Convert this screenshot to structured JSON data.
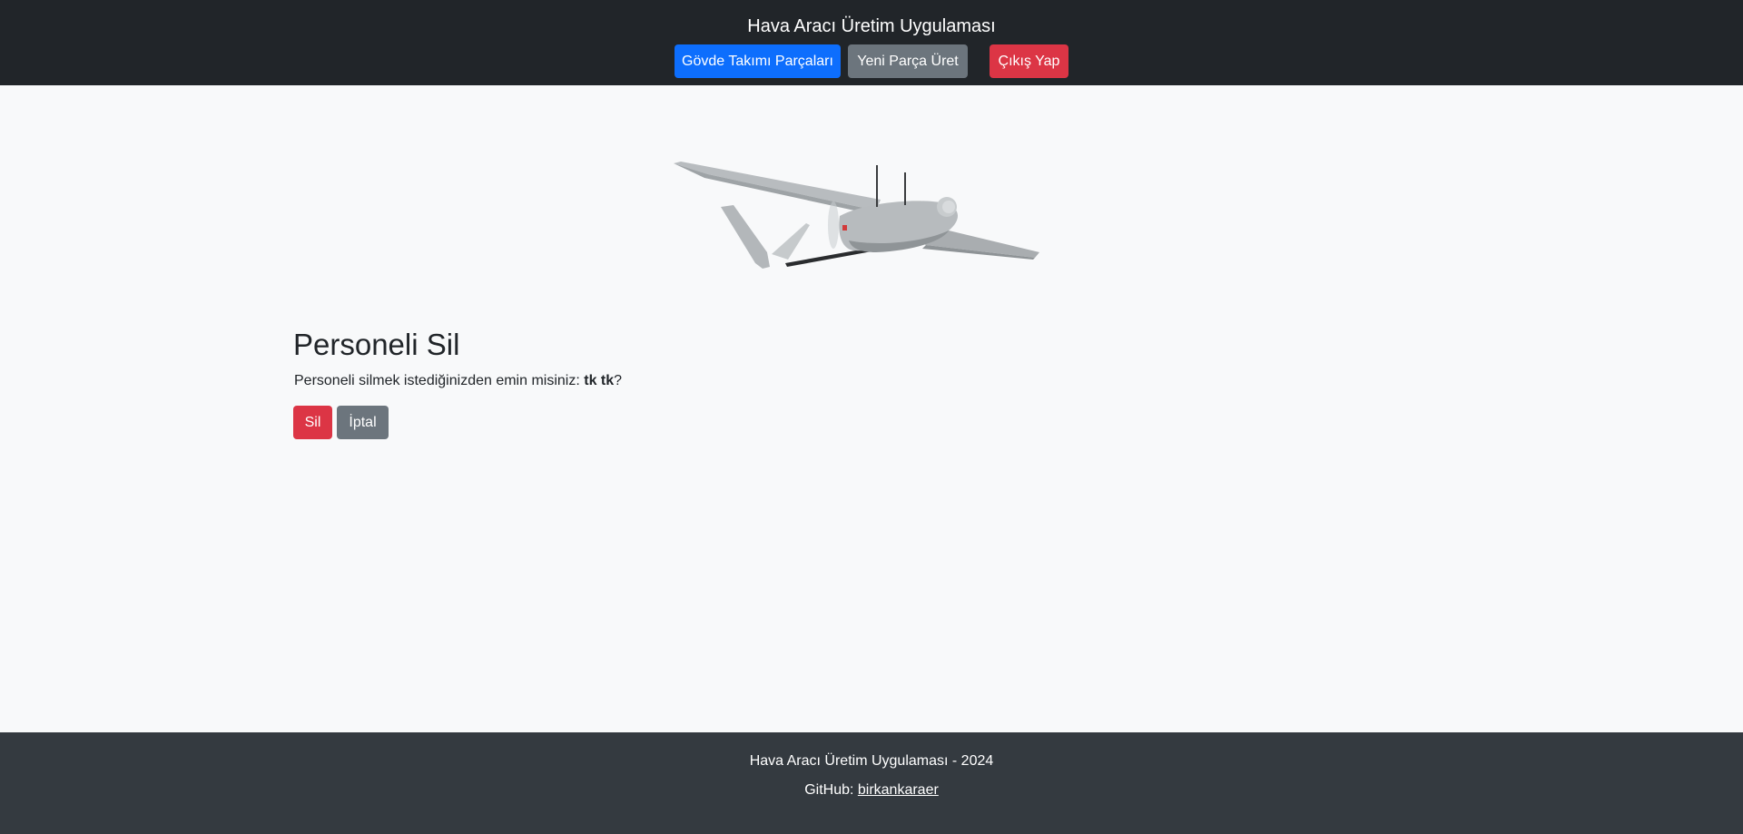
{
  "header": {
    "title": "Hava Aracı Üretim Uygulaması",
    "nav": {
      "parts_label": "Gövde Takımı Parçaları",
      "new_part_label": "Yeni Parça Üret",
      "logout_label": "Çıkış Yap"
    }
  },
  "main": {
    "title": "Personeli Sil",
    "confirm_prefix": "Personeli silmek istediğinizden emin misiniz: ",
    "person_name": "tk tk",
    "confirm_suffix": "?",
    "delete_label": "Sil",
    "cancel_label": "İptal"
  },
  "footer": {
    "copyright": "Hava Aracı Üretim Uygulaması - 2024",
    "github_prefix": "GitHub: ",
    "github_user": "birkankaraer"
  },
  "colors": {
    "header_bg": "#212529",
    "footer_bg": "#343a40",
    "primary": "#0d6efd",
    "secondary": "#6c757d",
    "danger": "#dc3545",
    "page_bg": "#f8f9fa"
  }
}
